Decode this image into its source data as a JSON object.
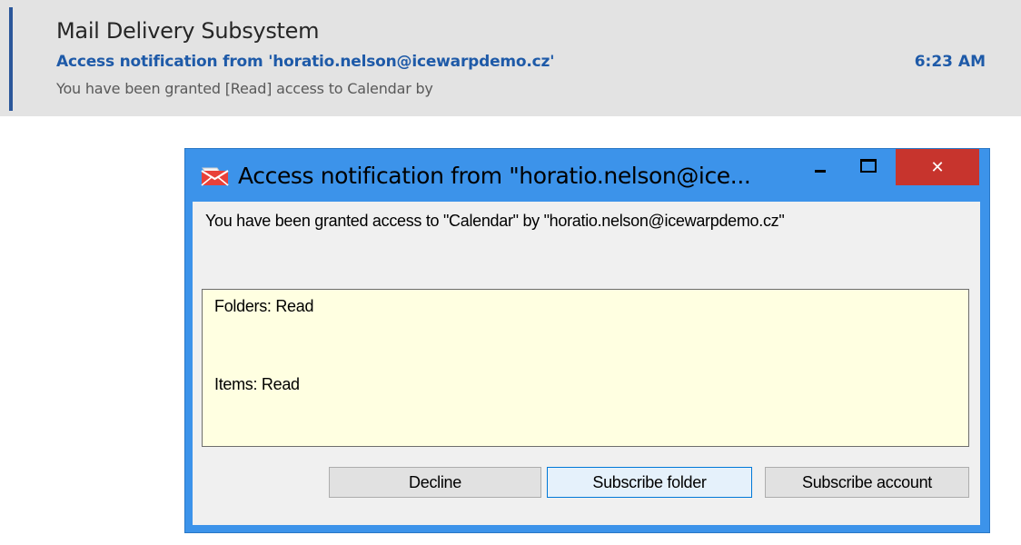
{
  "mail_item": {
    "sender": "Mail Delivery Subsystem",
    "subject": "Access notification from 'horatio.nelson@icewarpdemo.cz'",
    "time": "6:23 AM",
    "preview": "You have been granted [Read] access to Calendar by"
  },
  "dialog": {
    "title": "Access notification from \"horatio.nelson@ice...",
    "icon": "mail-icon",
    "close_glyph": "✕",
    "message": "You have been granted access to \"Calendar\" by \"horatio.nelson@icewarpdemo.cz\"",
    "permissions": {
      "folders": "Folders: Read",
      "items": "Items: Read"
    },
    "buttons": {
      "decline": "Decline",
      "subscribe_folder": "Subscribe folder",
      "subscribe_account": "Subscribe account"
    }
  },
  "colors": {
    "accent_bar": "#2b579a",
    "subject_blue": "#1e5aa8",
    "window_frame": "#3c93ea",
    "close_button": "#c7342d",
    "info_background": "#ffffe1",
    "row_background": "#e3e3e3"
  }
}
